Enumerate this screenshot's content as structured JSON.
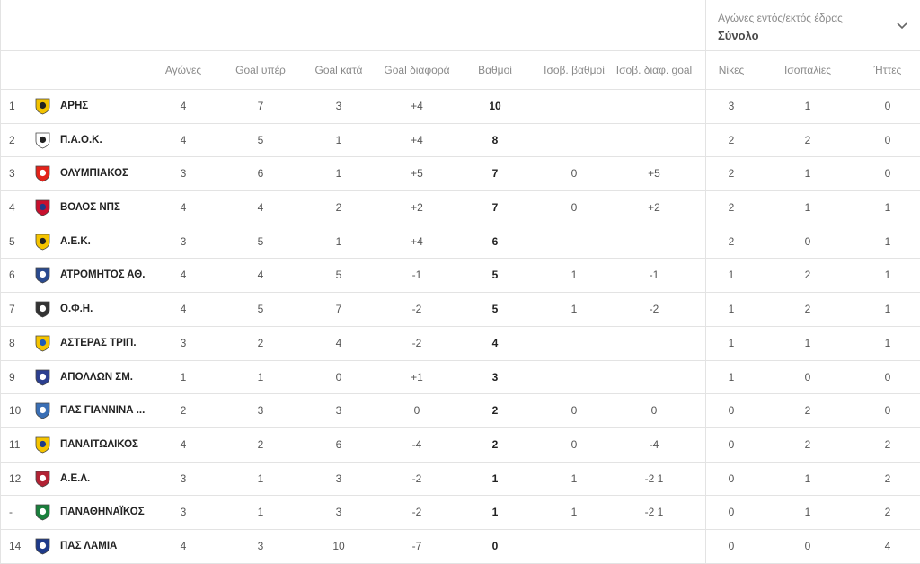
{
  "filter": {
    "label": "Αγώνες εντός/εκτός έδρας",
    "value": "Σύνολο",
    "icon": "chevron-down-icon"
  },
  "headers": {
    "played": "Αγώνες",
    "goals_for": "Goal υπέρ",
    "goals_against": "Goal κατά",
    "goal_diff": "Goal διαφορά",
    "points": "Βαθμοί",
    "h2h_points": "Ισοβ. βαθμοί",
    "h2h_goal_diff": "Ισοβ. διαφ. goal",
    "wins": "Νίκες",
    "draws": "Ισοπαλίες",
    "losses": "Ήττες"
  },
  "rows": [
    {
      "rank": "1",
      "team": "ΑΡΗΣ",
      "crest": {
        "icon": "aris-crest-icon",
        "primary": "#f2c200",
        "secondary": "#222222"
      },
      "played": "4",
      "gf": "7",
      "ga": "3",
      "gd": "+4",
      "pts": "10",
      "hpts": "",
      "hgd": "",
      "w": "3",
      "d": "1",
      "l": "0"
    },
    {
      "rank": "2",
      "team": "Π.Α.Ο.Κ.",
      "crest": {
        "icon": "paok-crest-icon",
        "primary": "#ffffff",
        "secondary": "#222222"
      },
      "played": "4",
      "gf": "5",
      "ga": "1",
      "gd": "+4",
      "pts": "8",
      "hpts": "",
      "hgd": "",
      "w": "2",
      "d": "2",
      "l": "0"
    },
    {
      "rank": "3",
      "team": "ΟΛΥΜΠΙΑΚΟΣ",
      "crest": {
        "icon": "olympiacos-crest-icon",
        "primary": "#e2231a",
        "secondary": "#ffffff"
      },
      "played": "3",
      "gf": "6",
      "ga": "1",
      "gd": "+5",
      "pts": "7",
      "hpts": "0",
      "hgd": "+5",
      "w": "2",
      "d": "1",
      "l": "0"
    },
    {
      "rank": "4",
      "team": "ΒΟΛΟΣ ΝΠΣ",
      "crest": {
        "icon": "volos-crest-icon",
        "primary": "#c8102e",
        "secondary": "#1e3a8a"
      },
      "played": "4",
      "gf": "4",
      "ga": "2",
      "gd": "+2",
      "pts": "7",
      "hpts": "0",
      "hgd": "+2",
      "w": "2",
      "d": "1",
      "l": "1"
    },
    {
      "rank": "5",
      "team": "Α.Ε.Κ.",
      "crest": {
        "icon": "aek-crest-icon",
        "primary": "#f5c400",
        "secondary": "#222222"
      },
      "played": "3",
      "gf": "5",
      "ga": "1",
      "gd": "+4",
      "pts": "6",
      "hpts": "",
      "hgd": "",
      "w": "2",
      "d": "0",
      "l": "1"
    },
    {
      "rank": "6",
      "team": "ΑΤΡΟΜΗΤΟΣ ΑΘ.",
      "crest": {
        "icon": "atromitos-crest-icon",
        "primary": "#2a4a8f",
        "secondary": "#ffffff"
      },
      "played": "4",
      "gf": "4",
      "ga": "5",
      "gd": "-1",
      "pts": "5",
      "hpts": "1",
      "hgd": "-1",
      "w": "1",
      "d": "2",
      "l": "1"
    },
    {
      "rank": "7",
      "team": "Ο.Φ.Η.",
      "crest": {
        "icon": "ofi-crest-icon",
        "primary": "#333333",
        "secondary": "#ffffff"
      },
      "played": "4",
      "gf": "5",
      "ga": "7",
      "gd": "-2",
      "pts": "5",
      "hpts": "1",
      "hgd": "-2",
      "w": "1",
      "d": "2",
      "l": "1"
    },
    {
      "rank": "8",
      "team": "ΑΣΤΕΡΑΣ ΤΡΙΠ.",
      "crest": {
        "icon": "asteras-crest-icon",
        "primary": "#f5c400",
        "secondary": "#1e5bb8"
      },
      "played": "3",
      "gf": "2",
      "ga": "4",
      "gd": "-2",
      "pts": "4",
      "hpts": "",
      "hgd": "",
      "w": "1",
      "d": "1",
      "l": "1"
    },
    {
      "rank": "9",
      "team": "ΑΠΟΛΛΩΝ ΣΜ.",
      "crest": {
        "icon": "apollon-crest-icon",
        "primary": "#2c3f8f",
        "secondary": "#ffffff"
      },
      "played": "1",
      "gf": "1",
      "ga": "0",
      "gd": "+1",
      "pts": "3",
      "hpts": "",
      "hgd": "",
      "w": "1",
      "d": "0",
      "l": "0"
    },
    {
      "rank": "10",
      "team": "ΠΑΣ ΓΙΑΝΝΙΝΑ ...",
      "crest": {
        "icon": "pas-giannina-crest-icon",
        "primary": "#3a6fb5",
        "secondary": "#ffffff"
      },
      "played": "2",
      "gf": "3",
      "ga": "3",
      "gd": "0",
      "pts": "2",
      "hpts": "0",
      "hgd": "0",
      "w": "0",
      "d": "2",
      "l": "0"
    },
    {
      "rank": "11",
      "team": "ΠΑΝΑΙΤΩΛΙΚΟΣ",
      "crest": {
        "icon": "panetolikos-crest-icon",
        "primary": "#f5c400",
        "secondary": "#1e3a8a"
      },
      "played": "4",
      "gf": "2",
      "ga": "6",
      "gd": "-4",
      "pts": "2",
      "hpts": "0",
      "hgd": "-4",
      "w": "0",
      "d": "2",
      "l": "2"
    },
    {
      "rank": "12",
      "team": "Α.Ε.Λ.",
      "crest": {
        "icon": "ael-crest-icon",
        "primary": "#b22234",
        "secondary": "#ffffff"
      },
      "played": "3",
      "gf": "1",
      "ga": "3",
      "gd": "-2",
      "pts": "1",
      "hpts": "1",
      "hgd": "-2 1",
      "w": "0",
      "d": "1",
      "l": "2"
    },
    {
      "rank": "-",
      "team": "ΠΑΝΑΘΗΝΑΪΚΟΣ",
      "crest": {
        "icon": "panathinaikos-crest-icon",
        "primary": "#1a7f3c",
        "secondary": "#ffffff"
      },
      "played": "3",
      "gf": "1",
      "ga": "3",
      "gd": "-2",
      "pts": "1",
      "hpts": "1",
      "hgd": "-2 1",
      "w": "0",
      "d": "1",
      "l": "2"
    },
    {
      "rank": "14",
      "team": "ΠΑΣ ΛΑΜΙΑ",
      "crest": {
        "icon": "lamia-crest-icon",
        "primary": "#1e3a8a",
        "secondary": "#ffffff"
      },
      "played": "4",
      "gf": "3",
      "ga": "10",
      "gd": "-7",
      "pts": "0",
      "hpts": "",
      "hgd": "",
      "w": "0",
      "d": "0",
      "l": "4"
    }
  ]
}
